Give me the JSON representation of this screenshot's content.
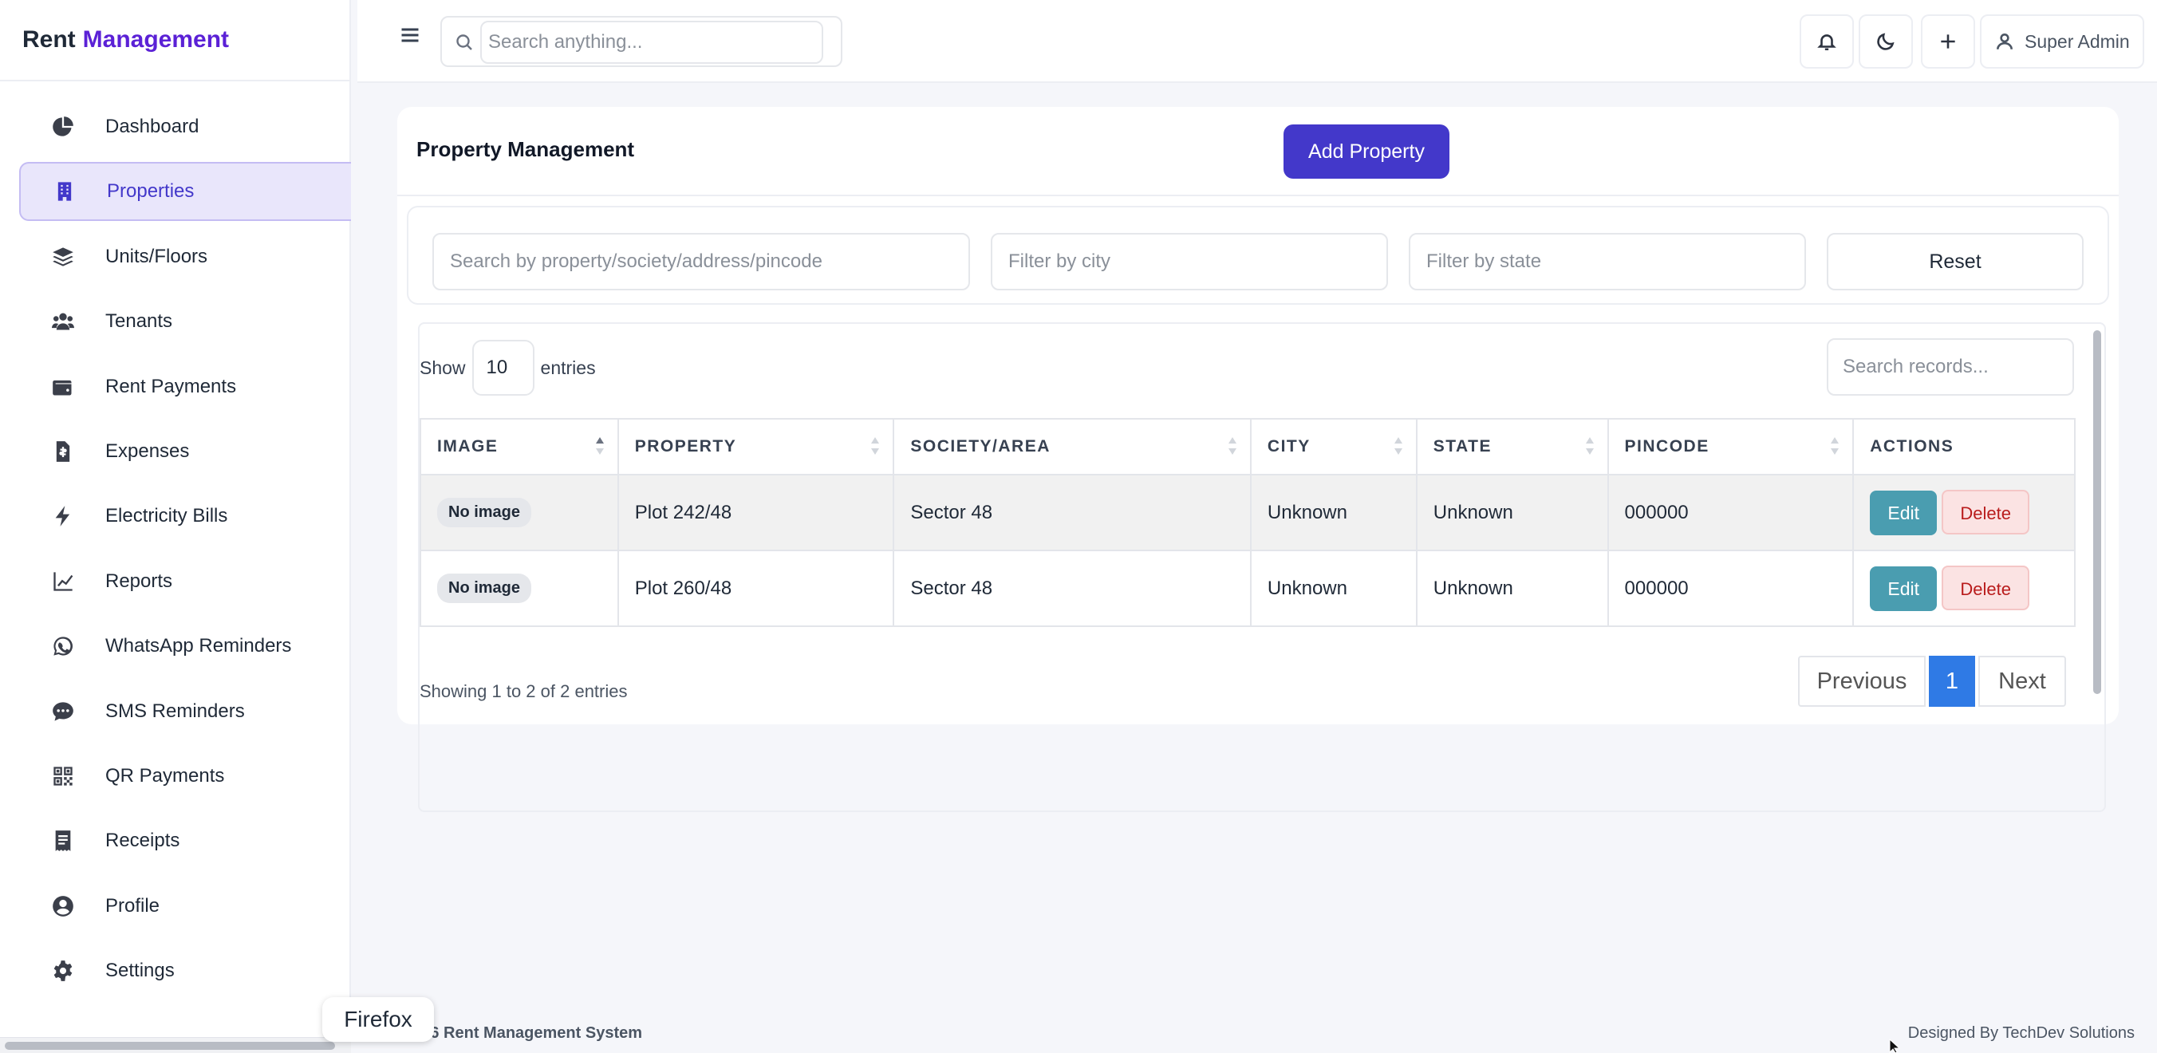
{
  "brand": {
    "part1": "Rent",
    "part2": "Management"
  },
  "sidebar": {
    "items": [
      {
        "label": "Dashboard",
        "icon": "pie-chart-icon"
      },
      {
        "label": "Properties",
        "icon": "building-icon",
        "active": true
      },
      {
        "label": "Units/Floors",
        "icon": "layers-icon"
      },
      {
        "label": "Tenants",
        "icon": "users-icon"
      },
      {
        "label": "Rent Payments",
        "icon": "wallet-icon"
      },
      {
        "label": "Expenses",
        "icon": "invoice-icon"
      },
      {
        "label": "Electricity Bills",
        "icon": "bolt-icon"
      },
      {
        "label": "Reports",
        "icon": "line-chart-icon"
      },
      {
        "label": "WhatsApp Reminders",
        "icon": "whatsapp-icon"
      },
      {
        "label": "SMS Reminders",
        "icon": "sms-icon"
      },
      {
        "label": "QR Payments",
        "icon": "qrcode-icon"
      },
      {
        "label": "Receipts",
        "icon": "receipt-icon"
      },
      {
        "label": "Profile",
        "icon": "user-circle-icon"
      },
      {
        "label": "Settings",
        "icon": "gear-icon"
      }
    ]
  },
  "topbar": {
    "search_placeholder": "Search anything...",
    "user_label": "Super Admin"
  },
  "card": {
    "title": "Property Management",
    "add_button": "Add Property",
    "filters": {
      "search_placeholder": "Search by property/society/address/pincode",
      "city_placeholder": "Filter by city",
      "state_placeholder": "Filter by state",
      "reset_label": "Reset"
    },
    "table": {
      "show_label": "Show",
      "entries_value": "10",
      "entries_label": "entries",
      "search_placeholder": "Search records...",
      "columns": [
        "IMAGE",
        "PROPERTY",
        "SOCIETY/AREA",
        "CITY",
        "STATE",
        "PINCODE",
        "ACTIONS"
      ],
      "rows": [
        {
          "image": "No image",
          "property": "Plot 242/48",
          "society": "Sector 48",
          "city": "Unknown",
          "state": "Unknown",
          "pincode": "000000",
          "edit": "Edit",
          "delete": "Delete"
        },
        {
          "image": "No image",
          "property": "Plot 260/48",
          "society": "Sector 48",
          "city": "Unknown",
          "state": "Unknown",
          "pincode": "000000",
          "edit": "Edit",
          "delete": "Delete"
        }
      ],
      "info": "Showing 1 to 2 of 2 entries",
      "pager": {
        "prev": "Previous",
        "current": "1",
        "next": "Next"
      }
    }
  },
  "footer": {
    "left": "2026 Rent Management System",
    "right": "Designed By TechDev Solutions"
  },
  "tooltip": "Firefox",
  "colors": {
    "accent": "#4338ca",
    "brand_accent": "#5b21d6",
    "edit": "#4a9db0",
    "delete_bg": "#fbe3e3",
    "page_current": "#2f7ae5"
  }
}
